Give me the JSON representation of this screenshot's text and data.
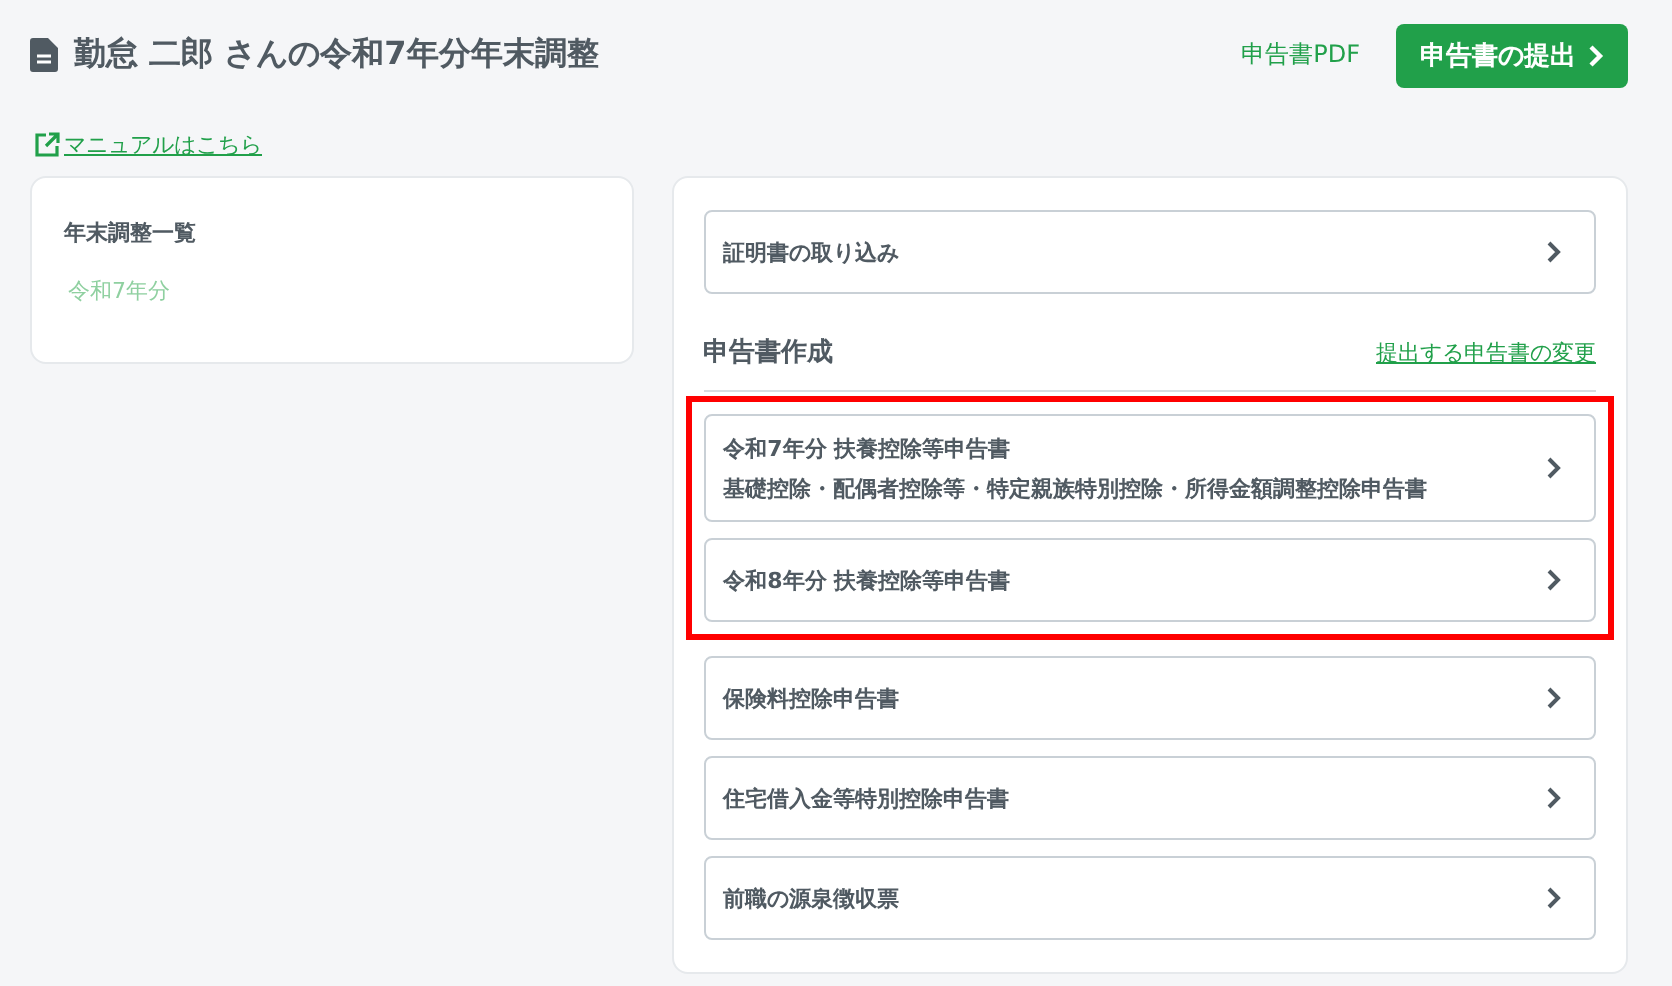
{
  "header": {
    "title": "勤怠 二郎 さんの令和7年分年末調整",
    "pdf_link": "申告書PDF",
    "submit_button": "申告書の提出"
  },
  "manual_link": "マニュアルはこちら",
  "sidebar": {
    "title": "年末調整一覧",
    "items": [
      {
        "label": "令和7年分",
        "selected": false
      }
    ]
  },
  "import_item": {
    "label": "証明書の取り込み"
  },
  "section": {
    "title": "申告書作成",
    "change_link": "提出する申告書の変更"
  },
  "form_items": [
    {
      "label": "令和7年分 扶養控除等申告書",
      "sublabel": "基礎控除・配偶者控除等・特定親族特別控除・所得金額調整控除申告書",
      "highlighted": true
    },
    {
      "label": "令和8年分 扶養控除等申告書",
      "highlighted": true
    },
    {
      "label": "保険料控除申告書",
      "highlighted": false
    },
    {
      "label": "住宅借入金等特別控除申告書",
      "highlighted": false
    },
    {
      "label": "前職の源泉徴収票",
      "highlighted": false
    }
  ]
}
